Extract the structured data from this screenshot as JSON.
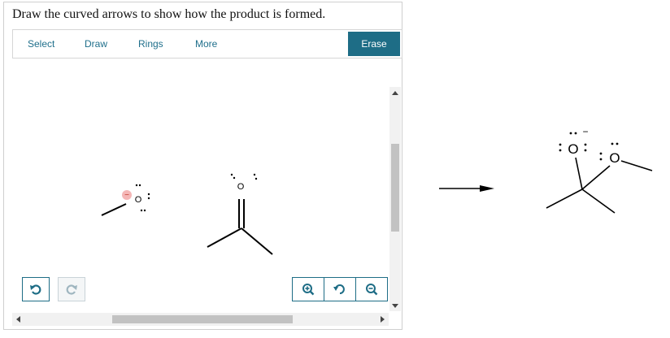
{
  "prompt": "Draw the curved arrows to show how the product is formed.",
  "toolbar": {
    "select_label": "Select",
    "draw_label": "Draw",
    "rings_label": "Rings",
    "more_label": "More",
    "erase_label": "Erase"
  },
  "canvas": {
    "methoxide_O": "O",
    "methoxide_charge": "−",
    "acetone_O": "O"
  },
  "product": {
    "O_minus": "O",
    "O_minus_charge": "−",
    "O_ether": "O"
  },
  "icons": {
    "undo": "undo-icon",
    "redo": "redo-icon",
    "zoom_in": "zoom-in-icon",
    "reset": "reset-zoom-icon",
    "zoom_out": "zoom-out-icon"
  },
  "colors": {
    "accent": "#1e6d86",
    "charge_highlight": "#f4b6b6"
  }
}
